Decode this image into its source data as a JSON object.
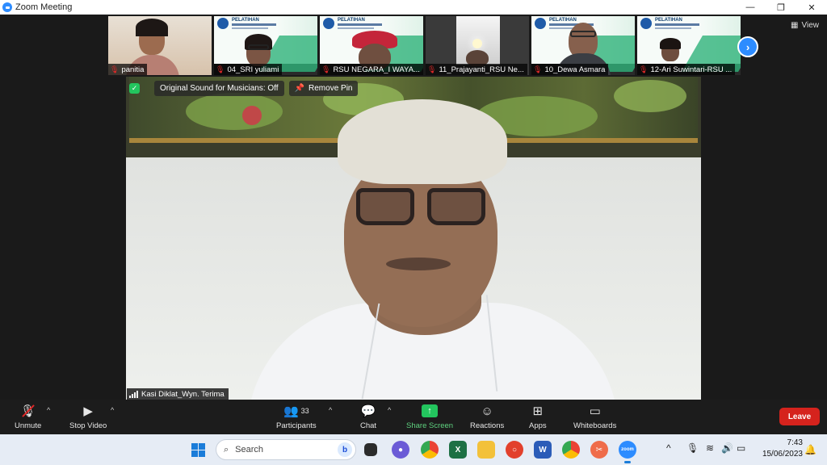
{
  "window": {
    "title": "Zoom Meeting",
    "controls": {
      "minimize": "—",
      "restore": "❐",
      "close": "✕"
    }
  },
  "gallery": {
    "participants": [
      {
        "name": "panitia",
        "muted": true
      },
      {
        "name": "04_SRI yuliami",
        "muted": true
      },
      {
        "name": "RSU NEGARA_I WAYA...",
        "muted": true
      },
      {
        "name": "11_Prajayanti_RSU Ne...",
        "muted": true
      },
      {
        "name": "10_Dewa Asmara",
        "muted": true
      },
      {
        "name": "12-Ari Suwintari-RSU ...",
        "muted": true
      }
    ],
    "next_label": "›",
    "view_label": "View"
  },
  "slide": {
    "heading": "PELATIHAN"
  },
  "main_video": {
    "speaker_name": "Kasi Diklat_Wyn. Terima",
    "original_sound_label": "Original Sound for Musicians: Off",
    "remove_pin_label": "Remove Pin"
  },
  "toolbar": {
    "unmute": "Unmute",
    "stop_video": "Stop Video",
    "participants": "Participants",
    "participants_count": "33",
    "chat": "Chat",
    "share_screen": "Share Screen",
    "reactions": "Reactions",
    "apps": "Apps",
    "whiteboards": "Whiteboards",
    "leave": "Leave"
  },
  "taskbar": {
    "search_placeholder": "Search",
    "time": "7:43",
    "date": "15/06/2023"
  },
  "colors": {
    "accent": "#2d8cff",
    "share_green": "#23c55e",
    "leave_red": "#d5231d",
    "muted_red": "#e02828"
  },
  "icons": [
    "zoom-logo-icon",
    "mic-muted-icon",
    "video-camera-icon",
    "participants-icon",
    "chat-icon",
    "share-screen-icon",
    "reactions-icon",
    "apps-icon",
    "whiteboards-icon",
    "shield-icon",
    "pin-icon",
    "signal-bars-icon",
    "windows-start-icon",
    "search-icon"
  ]
}
